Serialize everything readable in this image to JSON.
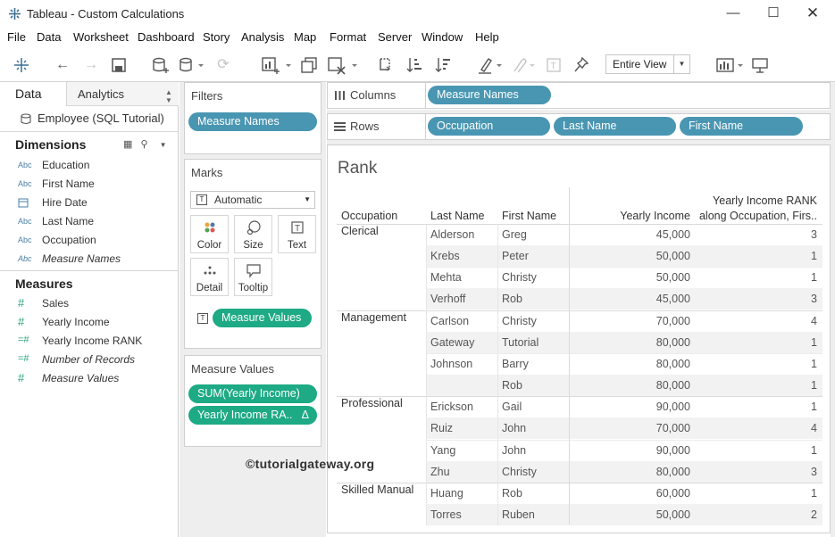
{
  "window": {
    "title": "Tableau - Custom Calculations",
    "min_icon": "minimize-icon",
    "max_icon": "maximize-icon",
    "close_icon": "close-icon"
  },
  "menu": [
    "File",
    "Data",
    "Worksheet",
    "Dashboard",
    "Story",
    "Analysis",
    "Map",
    "Format",
    "Server",
    "Window",
    "Help"
  ],
  "toolbar": {
    "view_select": "Entire View"
  },
  "left_pane": {
    "tabs": {
      "data": "Data",
      "analytics": "Analytics"
    },
    "datasource": "Employee (SQL Tutorial)",
    "dimensions_label": "Dimensions",
    "dimensions": [
      {
        "type": "Abc",
        "name": "Education"
      },
      {
        "type": "Abc",
        "name": "First Name"
      },
      {
        "type": "date",
        "name": "Hire Date"
      },
      {
        "type": "Abc",
        "name": "Last Name"
      },
      {
        "type": "Abc",
        "name": "Occupation"
      },
      {
        "type": "Abc",
        "name": "Measure Names"
      }
    ],
    "measures_label": "Measures",
    "measures": [
      {
        "type": "#",
        "name": "Sales"
      },
      {
        "type": "#",
        "name": "Yearly Income"
      },
      {
        "type": "=#",
        "name": "Yearly Income RANK"
      },
      {
        "type": "=#",
        "name": "Number of Records"
      },
      {
        "type": "#",
        "name": "Measure Values"
      }
    ]
  },
  "cards": {
    "filters_title": "Filters",
    "filters_pill": "Measure Names",
    "marks_title": "Marks",
    "mark_type": "Automatic",
    "mark_buttons": {
      "color": "Color",
      "size": "Size",
      "text": "Text",
      "detail": "Detail",
      "tooltip": "Tooltip"
    },
    "marks_pill": "Measure Values",
    "measure_values_title": "Measure Values",
    "mv_pill_1": "SUM(Yearly Income)",
    "mv_pill_2": "Yearly Income RA.."
  },
  "shelves": {
    "columns_label": "Columns",
    "columns_pill": "Measure Names",
    "rows_label": "Rows",
    "rows_pills": [
      "Occupation",
      "Last Name",
      "First Name"
    ]
  },
  "sheet": {
    "title": "Rank",
    "headers": {
      "occupation": "Occupation",
      "last_name": "Last Name",
      "first_name": "First Name",
      "yearly_income": "Yearly Income",
      "rank_line1": "Yearly Income RANK",
      "rank_line2": "along Occupation, Firs.."
    },
    "rows": [
      {
        "occupation": "Clerical",
        "last": "Alderson",
        "first": "Greg",
        "income": "45,000",
        "rank": "3"
      },
      {
        "occupation": "",
        "last": "Krebs",
        "first": "Peter",
        "income": "50,000",
        "rank": "1"
      },
      {
        "occupation": "",
        "last": "Mehta",
        "first": "Christy",
        "income": "50,000",
        "rank": "1"
      },
      {
        "occupation": "",
        "last": "Verhoff",
        "first": "Rob",
        "income": "45,000",
        "rank": "3"
      },
      {
        "occupation": "Management",
        "last": "Carlson",
        "first": "Christy",
        "income": "70,000",
        "rank": "4"
      },
      {
        "occupation": "",
        "last": "Gateway",
        "first": "Tutorial",
        "income": "80,000",
        "rank": "1"
      },
      {
        "occupation": "",
        "last": "Johnson",
        "first": "Barry",
        "income": "80,000",
        "rank": "1"
      },
      {
        "occupation": "",
        "last": "",
        "first": "Rob",
        "income": "80,000",
        "rank": "1"
      },
      {
        "occupation": "Professional",
        "last": "Erickson",
        "first": "Gail",
        "income": "90,000",
        "rank": "1"
      },
      {
        "occupation": "",
        "last": "Ruiz",
        "first": "John",
        "income": "70,000",
        "rank": "4"
      },
      {
        "occupation": "",
        "last": "Yang",
        "first": "John",
        "income": "90,000",
        "rank": "1"
      },
      {
        "occupation": "",
        "last": "Zhu",
        "first": "Christy",
        "income": "80,000",
        "rank": "3"
      },
      {
        "occupation": "Skilled Manual",
        "last": "Huang",
        "first": "Rob",
        "income": "60,000",
        "rank": "1"
      },
      {
        "occupation": "",
        "last": "Torres",
        "first": "Ruben",
        "income": "50,000",
        "rank": "2"
      }
    ],
    "watermark": "©tutorialgateway.org"
  },
  "colors": {
    "blue_pill": "#4996b2",
    "green_pill": "#1daa84",
    "band": "#f2f2f2"
  }
}
